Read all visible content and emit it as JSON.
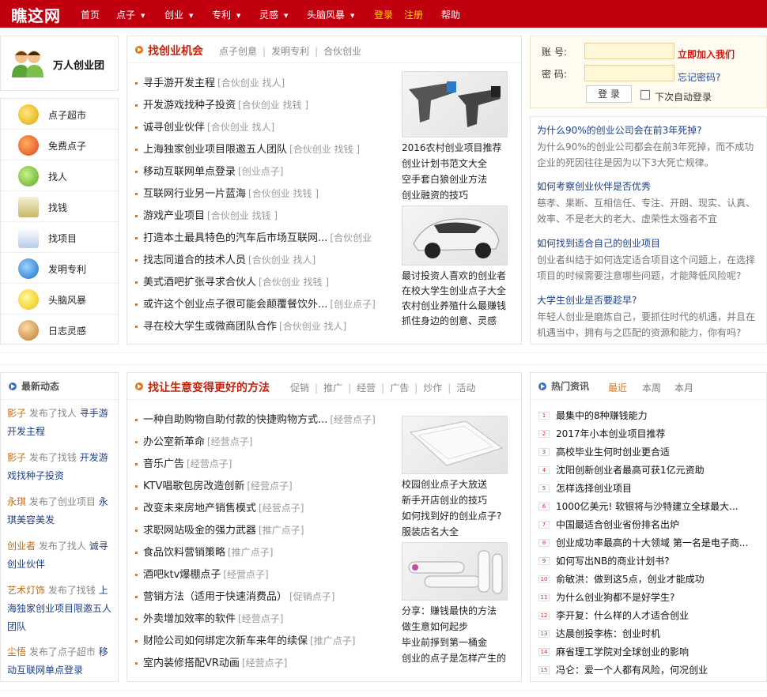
{
  "nav": {
    "logo": "瞧这网",
    "items": [
      {
        "label": "首页"
      },
      {
        "label": "点子"
      },
      {
        "label": "创业"
      },
      {
        "label": "专利"
      },
      {
        "label": "灵感"
      },
      {
        "label": "头脑风暴"
      }
    ],
    "login": "登录",
    "register": "注册",
    "help": "帮助"
  },
  "sidebar": {
    "team_label": "万人创业团",
    "categories": [
      {
        "label": "点子超市",
        "icon": "coins-icon"
      },
      {
        "label": "免费点子",
        "icon": "apple-icon"
      },
      {
        "label": "找人",
        "icon": "handshake-icon"
      },
      {
        "label": "找钱",
        "icon": "cash-register-icon"
      },
      {
        "label": "找项目",
        "icon": "document-search-icon"
      },
      {
        "label": "发明专利",
        "icon": "globe-icon"
      },
      {
        "label": "头脑风暴",
        "icon": "lightbulb-icon"
      },
      {
        "label": "日志灵感",
        "icon": "person-icon"
      }
    ]
  },
  "chance": {
    "title": "找创业机会",
    "tabs": [
      "点子创意",
      "发明专利",
      "合伙创业"
    ],
    "items": [
      {
        "text": "寻手游开发主程",
        "tag": "[合伙创业 找人]"
      },
      {
        "text": "开发游戏找种子投资",
        "tag": "[合伙创业 找钱 ]"
      },
      {
        "text": "诚寻创业伙伴",
        "tag": "[合伙创业 找人]"
      },
      {
        "text": "上海独家创业项目限邀五人团队",
        "tag": "[合伙创业 找钱 ]"
      },
      {
        "text": "移动互联网单点登录",
        "tag": "[创业点子]"
      },
      {
        "text": "互联网行业另一片蓝海",
        "tag": "[合伙创业 找钱 ]"
      },
      {
        "text": "游戏产业项目",
        "tag": "[合伙创业 找钱 ]"
      },
      {
        "text": "打造本土最具特色的汽车后市场互联网...",
        "tag": "[合伙创业"
      },
      {
        "text": "找志同道合的技术人员",
        "tag": "[合伙创业 找人]"
      },
      {
        "text": "美式酒吧扩张寻求合伙人",
        "tag": "[合伙创业 找钱 ]"
      },
      {
        "text": "或许这个创业点子很可能会颠覆餐饮外...",
        "tag": "[创业点子]"
      },
      {
        "text": "寻在校大学生或微商团队合作",
        "tag": "[合伙创业 找人]"
      }
    ],
    "side_links_1": [
      "2016农村创业项目推荐",
      "创业计划书范文大全",
      "空手套白狼创业方法",
      "创业融资的技巧"
    ],
    "side_links_2": [
      "最讨投资人喜欢的创业者",
      "在校大学生创业点子大全",
      "农村创业养殖什么最赚钱",
      "抓住身边的创意、灵感"
    ]
  },
  "login": {
    "account_label": "账  号:",
    "password_label": "密  码:",
    "join": "立即加入我们",
    "forgot": "忘记密码?",
    "button": "登 录",
    "auto": "下次自动登录"
  },
  "faq": [
    {
      "q": "为什么90%的创业公司会在前3年死掉?",
      "a": "为什么90%的创业公司都会在前3年死掉，而不成功企业的死因往往是因为以下3大死亡规律。"
    },
    {
      "q": "如何考察创业伙伴是否优秀",
      "a": "慈孝、果断、互相信任、专注、开朗、现实、认真、效率、不是老大的老大、虚荣性太强者不宜"
    },
    {
      "q": "如何找到适合自己的创业项目",
      "a": "创业者纠结于如何选定适合项目这个问题上，在选择项目的时候需要注意哪些问题，才能降低风险呢?"
    },
    {
      "q": "大学生创业是否要趁早?",
      "a": "年轻人创业是磨炼自己，要抓住时代的机遇，并且在机遇当中，拥有与之匹配的资源和能力，你有吗?"
    }
  ],
  "activity": {
    "title": "最新动态",
    "items": [
      {
        "user": "影子",
        "action": "发布了找人",
        "link": "寻手游开发主程"
      },
      {
        "user": "影子",
        "action": "发布了找钱",
        "link": "开发游戏找种子投资"
      },
      {
        "user": "永琪",
        "action": "发布了创业项目",
        "link": "永琪美容美发"
      },
      {
        "user": "创业者",
        "action": "发布了找人",
        "link": "诚寻创业伙伴"
      },
      {
        "user": "艺术灯饰",
        "action": "发布了找钱",
        "link": "上海独家创业项目限邀五人团队"
      },
      {
        "user": "尘悟",
        "action": "发布了点子超市",
        "link": "移动互联网单点登录"
      }
    ]
  },
  "method": {
    "title": "找让生意变得更好的方法",
    "tabs": [
      "促销",
      "推广",
      "经营",
      "广告",
      "炒作",
      "活动"
    ],
    "items": [
      {
        "text": "一种自助购物自助付款的快捷购物方式...",
        "tag": "[经营点子]"
      },
      {
        "text": "办公室新革命",
        "tag": "[经营点子]"
      },
      {
        "text": "音乐广告",
        "tag": "[经营点子]"
      },
      {
        "text": "KTV唱歌包房改造创新",
        "tag": "[经营点子]"
      },
      {
        "text": "改变未来房地产销售模式",
        "tag": "[经营点子]"
      },
      {
        "text": "求职网站吸金的强力武器",
        "tag": "[推广点子]"
      },
      {
        "text": "食品饮料营销策略",
        "tag": "[推广点子]"
      },
      {
        "text": "酒吧ktv爆棚点子",
        "tag": "[经营点子]"
      },
      {
        "text": "营销方法（适用于快速消费品）",
        "tag": "[促销点子]"
      },
      {
        "text": "外卖增加效率的软件",
        "tag": "[经营点子]"
      },
      {
        "text": "财险公司如何绑定次新车来年的续保",
        "tag": "[推广点子]"
      },
      {
        "text": "室内装修搭配VR动画",
        "tag": "[经营点子]"
      }
    ],
    "side_links_1": [
      "校园创业点子大放送",
      "新手开店创业的技巧",
      "如何找到好的创业点子?",
      "服装店名大全"
    ],
    "side_links_2": [
      "分享：赚钱最快的方法",
      "做生意如何起步",
      "毕业前掙到第一桶金",
      "创业的点子是怎样产生的"
    ]
  },
  "hot": {
    "title": "热门资讯",
    "tabs": [
      "最近",
      "本周",
      "本月"
    ],
    "items": [
      "最集中的8种赚钱能力",
      "2017年小本创业项目推荐",
      "高校毕业生何时创业更合适",
      "沈阳创新创业者最高可获1亿元资助",
      "怎样选择创业项目",
      "1000亿美元! 软银将与沙特建立全球最大...",
      "中国最适合创业省份排名出炉",
      "创业成功率最高的十大领域 第一名是电子商...",
      "如何写出NB的商业计划书?",
      "俞敏洪：做到这5点，创业才能成功",
      "为什么创业狗都不是好学生?",
      "李开复：什么样的人才适合创业",
      "达晨创投李栋：创业时机",
      "麻省理工学院对全球创业的影响",
      "冯仑：爱一个人都有风险，何况创业"
    ]
  },
  "colors": {
    "brand_red": "#c0000e",
    "accent_orange": "#e8720c",
    "link_blue": "#1a3f8b"
  }
}
